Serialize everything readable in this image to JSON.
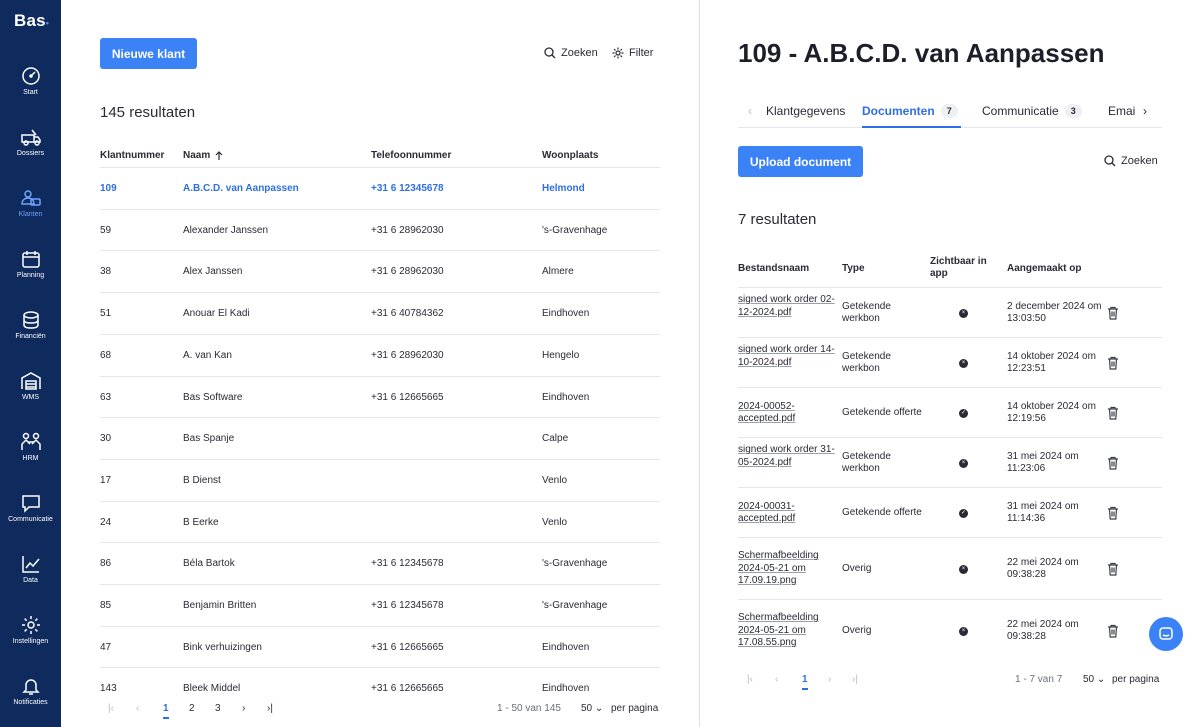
{
  "brand": {
    "name": "Bas"
  },
  "sidebar": {
    "items": [
      {
        "label": "Start",
        "icon": "gauge-icon"
      },
      {
        "label": "Dossiers",
        "icon": "truck-icon"
      },
      {
        "label": "Klanten",
        "icon": "users-icon",
        "active": true
      },
      {
        "label": "Planning",
        "icon": "calendar-icon"
      },
      {
        "label": "Financiën",
        "icon": "coins-icon"
      },
      {
        "label": "WMS",
        "icon": "warehouse-icon"
      },
      {
        "label": "HRM",
        "icon": "people-icon"
      },
      {
        "label": "Communicatie",
        "icon": "chat-icon"
      },
      {
        "label": "Data",
        "icon": "chart-icon"
      },
      {
        "label": "Instellingen",
        "icon": "gear-icon"
      },
      {
        "label": "Notificaties",
        "icon": "bell-icon"
      }
    ]
  },
  "customers": {
    "new_button": "Nieuwe klant",
    "search_label": "Zoeken",
    "filter_label": "Filter",
    "results": "145 resultaten",
    "columns": [
      "Klantnummer",
      "Naam",
      "Telefoonnummer",
      "Woonplaats"
    ],
    "rows": [
      {
        "num": "109",
        "name": "A.B.C.D. van Aanpassen",
        "phone": "+31 6 12345678",
        "city": "Helmond",
        "selected": true
      },
      {
        "num": "59",
        "name": "Alexander Janssen",
        "phone": "+31 6 28962030",
        "city": "'s-Gravenhage"
      },
      {
        "num": "38",
        "name": "Alex Janssen",
        "phone": "+31 6 28962030",
        "city": "Almere"
      },
      {
        "num": "51",
        "name": "Anouar El Kadi",
        "phone": "+31 6 40784362",
        "city": "Eindhoven"
      },
      {
        "num": "68",
        "name": "A. van Kan",
        "phone": "+31 6 28962030",
        "city": "Hengelo"
      },
      {
        "num": "63",
        "name": "Bas Software",
        "phone": "+31 6 12665665",
        "city": "Eindhoven"
      },
      {
        "num": "30",
        "name": "Bas Spanje",
        "phone": "",
        "city": "Calpe"
      },
      {
        "num": "17",
        "name": "B Dienst",
        "phone": "",
        "city": "Venlo"
      },
      {
        "num": "24",
        "name": "B Eerke",
        "phone": "",
        "city": "Venlo"
      },
      {
        "num": "86",
        "name": "Béla Bartok",
        "phone": "+31 6 12345678",
        "city": "'s-Gravenhage"
      },
      {
        "num": "85",
        "name": "Benjamin Britten",
        "phone": "+31 6 12345678",
        "city": "'s-Gravenhage"
      },
      {
        "num": "47",
        "name": "Bink verhuizingen",
        "phone": "+31 6 12665665",
        "city": "Eindhoven"
      },
      {
        "num": "143",
        "name": "Bleek Middel",
        "phone": "+31 6 12665665",
        "city": "Eindhoven"
      }
    ],
    "pagination": {
      "pages": [
        "1",
        "2",
        "3"
      ],
      "current": "1",
      "range": "1 - 50 van 145",
      "per_page": "50",
      "per_page_label": "per pagina"
    }
  },
  "detail": {
    "title": "109 - A.B.C.D. van Aanpassen",
    "tabs": [
      {
        "label": "Klantgegevens",
        "count": ""
      },
      {
        "label": "Documenten",
        "count": "7",
        "active": true
      },
      {
        "label": "Communicatie",
        "count": "3"
      },
      {
        "label": "Emai",
        "count": ""
      }
    ],
    "upload_button": "Upload document",
    "search_label": "Zoeken",
    "results": "7 resultaten",
    "columns": [
      "Bestandsnaam",
      "Type",
      "Zichtbaar in app",
      "Aangemaakt op"
    ],
    "documents": [
      {
        "name": "signed work order 02-12-2024.pdf",
        "type": "Getekende werkbon",
        "visible": false,
        "created": "2 december 2024 om 13:03:50"
      },
      {
        "name": "signed work order 14-10-2024.pdf",
        "type": "Getekende werkbon",
        "visible": false,
        "created": "14 oktober 2024 om 12:23:51"
      },
      {
        "name": "2024-00052-accepted.pdf",
        "type": "Getekende offerte",
        "visible": true,
        "created": "14 oktober 2024 om 12:19:56"
      },
      {
        "name": "signed work order 31-05-2024.pdf",
        "type": "Getekende werkbon",
        "visible": false,
        "created": "31 mei 2024 om 11:23:06"
      },
      {
        "name": "2024-00031-accepted.pdf",
        "type": "Getekende offerte",
        "visible": true,
        "created": "31 mei 2024 om 11:14:36"
      },
      {
        "name": "Schermafbeelding 2024-05-21 om 17.09.19.png",
        "type": "Overig",
        "visible": false,
        "created": "22 mei 2024 om 09:38:28"
      },
      {
        "name": "Schermafbeelding 2024-05-21 om 17.08.55.png",
        "type": "Overig",
        "visible": false,
        "created": "22 mei 2024 om 09:38:28"
      }
    ],
    "pagination": {
      "current": "1",
      "range": "1 - 7 van 7",
      "per_page": "50",
      "per_page_label": "per pagina"
    }
  },
  "colors": {
    "sidebar": "#0f2a5c",
    "accent": "#3b82f6",
    "link": "#2f6fe4"
  }
}
